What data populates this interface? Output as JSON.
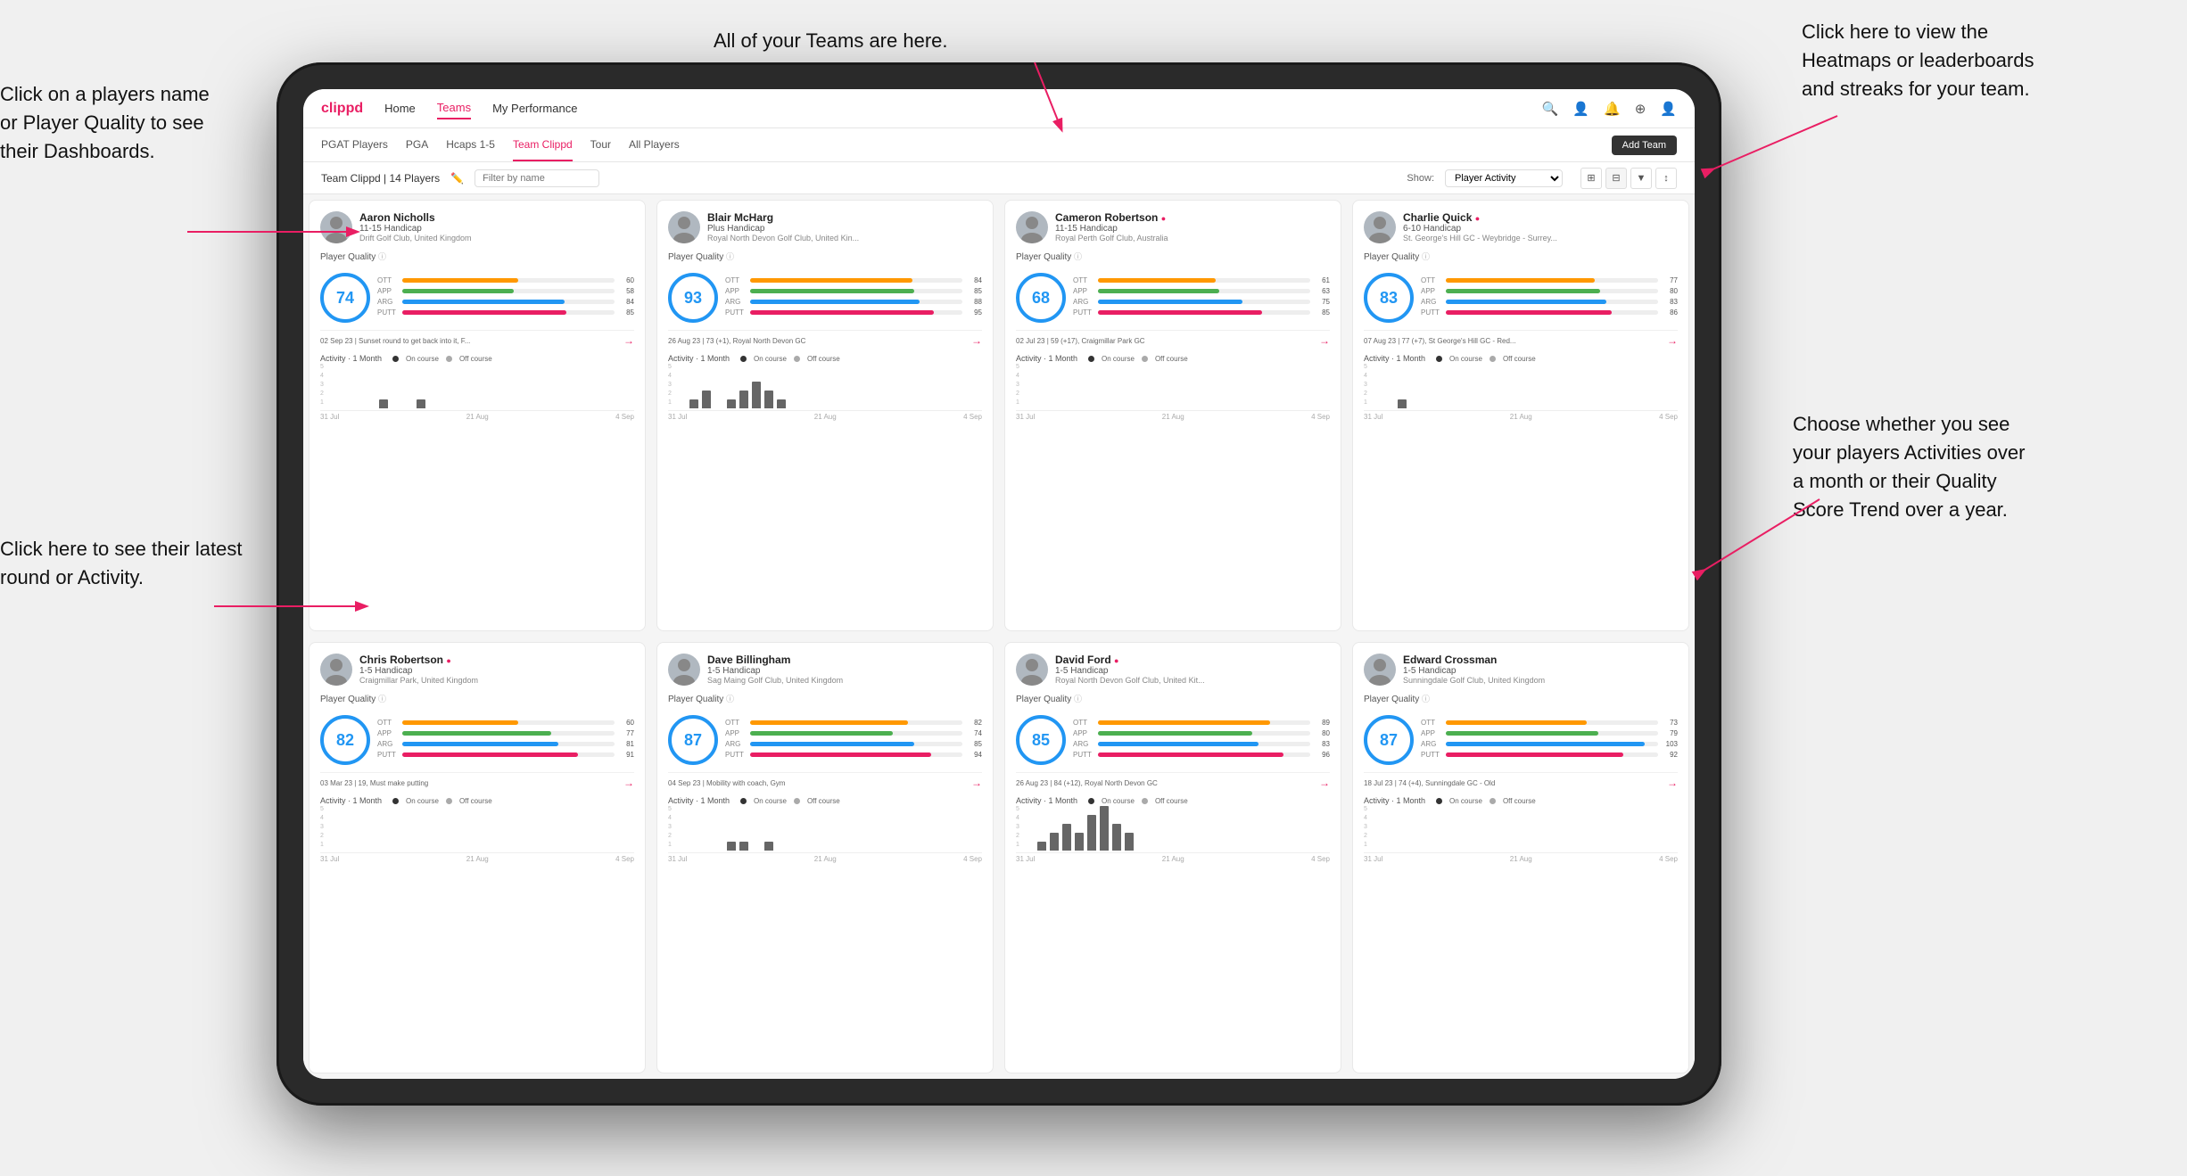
{
  "annotations": {
    "top_right_title": "Click here to view the\nHeatmaps or leaderboards\nand streaks for your team.",
    "top_center_title": "All of your Teams are here.",
    "left_top": "Click on a players name\nor Player Quality to see\ntheir Dashboards.",
    "left_bottom": "Click here to see their latest\nround or Activity.",
    "bottom_right": "Choose whether you see\nyour players Activities over\na month or their Quality\nScore Trend over a year."
  },
  "nav": {
    "logo": "clippd",
    "items": [
      "Home",
      "Teams",
      "My Performance"
    ],
    "active": "Teams",
    "icons": [
      "🔍",
      "👤",
      "🔔",
      "⊕",
      "👤"
    ]
  },
  "sub_nav": {
    "items": [
      "PGAT Players",
      "PGA",
      "Hcaps 1-5",
      "Team Clippd",
      "Tour",
      "All Players"
    ],
    "active": "Team Clippd",
    "add_button": "Add Team"
  },
  "team_header": {
    "title": "Team Clippd | 14 Players",
    "filter_placeholder": "Filter by name",
    "show_label": "Show:",
    "show_value": "Player Activity",
    "view_options": [
      "grid-2",
      "grid-4",
      "filter",
      "sort"
    ]
  },
  "players": [
    {
      "name": "Aaron Nicholls",
      "handicap": "11-15 Handicap",
      "club": "Drift Golf Club, United Kingdom",
      "verified": false,
      "score": 74,
      "score_color": "blue",
      "stats": [
        {
          "label": "OTT",
          "value": 60,
          "color": "#FF9800"
        },
        {
          "label": "APP",
          "value": 58,
          "color": "#4CAF50"
        },
        {
          "label": "ARG",
          "value": 84,
          "color": "#2196F3"
        },
        {
          "label": "PUTT",
          "value": 85,
          "color": "#e91e63"
        }
      ],
      "latest": "02 Sep 23 | Sunset round to get back into it, F...",
      "activity_bars": [
        0,
        0,
        0,
        0,
        1,
        0,
        0,
        1,
        0
      ],
      "chart_labels": [
        "31 Jul",
        "21 Aug",
        "4 Sep"
      ]
    },
    {
      "name": "Blair McHarg",
      "handicap": "Plus Handicap",
      "club": "Royal North Devon Golf Club, United Kin...",
      "verified": false,
      "score": 93,
      "score_color": "blue",
      "stats": [
        {
          "label": "OTT",
          "value": 84,
          "color": "#FF9800"
        },
        {
          "label": "APP",
          "value": 85,
          "color": "#4CAF50"
        },
        {
          "label": "ARG",
          "value": 88,
          "color": "#2196F3"
        },
        {
          "label": "PUTT",
          "value": 95,
          "color": "#e91e63"
        }
      ],
      "latest": "26 Aug 23 | 73 (+1), Royal North Devon GC",
      "activity_bars": [
        0,
        1,
        2,
        0,
        1,
        2,
        3,
        2,
        1
      ],
      "chart_labels": [
        "31 Jul",
        "21 Aug",
        "4 Sep"
      ]
    },
    {
      "name": "Cameron Robertson",
      "handicap": "11-15 Handicap",
      "club": "Royal Perth Golf Club, Australia",
      "verified": true,
      "score": 68,
      "score_color": "blue",
      "stats": [
        {
          "label": "OTT",
          "value": 61,
          "color": "#FF9800"
        },
        {
          "label": "APP",
          "value": 63,
          "color": "#4CAF50"
        },
        {
          "label": "ARG",
          "value": 75,
          "color": "#2196F3"
        },
        {
          "label": "PUTT",
          "value": 85,
          "color": "#e91e63"
        }
      ],
      "latest": "02 Jul 23 | 59 (+17), Craigmillar Park GC",
      "activity_bars": [
        0,
        0,
        0,
        0,
        0,
        0,
        0,
        0,
        0
      ],
      "chart_labels": [
        "31 Jul",
        "21 Aug",
        "4 Sep"
      ]
    },
    {
      "name": "Charlie Quick",
      "handicap": "6-10 Handicap",
      "club": "St. George's Hill GC - Weybridge - Surrey...",
      "verified": true,
      "score": 83,
      "score_color": "blue",
      "stats": [
        {
          "label": "OTT",
          "value": 77,
          "color": "#FF9800"
        },
        {
          "label": "APP",
          "value": 80,
          "color": "#4CAF50"
        },
        {
          "label": "ARG",
          "value": 83,
          "color": "#2196F3"
        },
        {
          "label": "PUTT",
          "value": 86,
          "color": "#e91e63"
        }
      ],
      "latest": "07 Aug 23 | 77 (+7), St George's Hill GC - Red...",
      "activity_bars": [
        0,
        0,
        1,
        0,
        0,
        0,
        0,
        0,
        0
      ],
      "chart_labels": [
        "31 Jul",
        "21 Aug",
        "4 Sep"
      ]
    },
    {
      "name": "Chris Robertson",
      "handicap": "1-5 Handicap",
      "club": "Craigmillar Park, United Kingdom",
      "verified": true,
      "score": 82,
      "score_color": "blue",
      "stats": [
        {
          "label": "OTT",
          "value": 60,
          "color": "#FF9800"
        },
        {
          "label": "APP",
          "value": 77,
          "color": "#4CAF50"
        },
        {
          "label": "ARG",
          "value": 81,
          "color": "#2196F3"
        },
        {
          "label": "PUTT",
          "value": 91,
          "color": "#e91e63"
        }
      ],
      "latest": "03 Mar 23 | 19, Must make putting",
      "activity_bars": [
        0,
        0,
        0,
        0,
        0,
        0,
        0,
        0,
        0
      ],
      "chart_labels": [
        "31 Jul",
        "21 Aug",
        "4 Sep"
      ]
    },
    {
      "name": "Dave Billingham",
      "handicap": "1-5 Handicap",
      "club": "Sag Maing Golf Club, United Kingdom",
      "verified": false,
      "score": 87,
      "score_color": "blue",
      "stats": [
        {
          "label": "OTT",
          "value": 82,
          "color": "#FF9800"
        },
        {
          "label": "APP",
          "value": 74,
          "color": "#4CAF50"
        },
        {
          "label": "ARG",
          "value": 85,
          "color": "#2196F3"
        },
        {
          "label": "PUTT",
          "value": 94,
          "color": "#e91e63"
        }
      ],
      "latest": "04 Sep 23 | Mobility with coach, Gym",
      "activity_bars": [
        0,
        0,
        0,
        0,
        1,
        1,
        0,
        1,
        0
      ],
      "chart_labels": [
        "31 Jul",
        "21 Aug",
        "4 Sep"
      ]
    },
    {
      "name": "David Ford",
      "handicap": "1-5 Handicap",
      "club": "Royal North Devon Golf Club, United Kit...",
      "verified": true,
      "score": 85,
      "score_color": "blue",
      "stats": [
        {
          "label": "OTT",
          "value": 89,
          "color": "#FF9800"
        },
        {
          "label": "APP",
          "value": 80,
          "color": "#4CAF50"
        },
        {
          "label": "ARG",
          "value": 83,
          "color": "#2196F3"
        },
        {
          "label": "PUTT",
          "value": 96,
          "color": "#e91e63"
        }
      ],
      "latest": "26 Aug 23 | 84 (+12), Royal North Devon GC",
      "activity_bars": [
        0,
        1,
        2,
        3,
        2,
        4,
        5,
        3,
        2
      ],
      "chart_labels": [
        "31 Jul",
        "21 Aug",
        "4 Sep"
      ]
    },
    {
      "name": "Edward Crossman",
      "handicap": "1-5 Handicap",
      "club": "Sunningdale Golf Club, United Kingdom",
      "verified": false,
      "score": 87,
      "score_color": "blue",
      "stats": [
        {
          "label": "OTT",
          "value": 73,
          "color": "#FF9800"
        },
        {
          "label": "APP",
          "value": 79,
          "color": "#4CAF50"
        },
        {
          "label": "ARG",
          "value": 103,
          "color": "#2196F3"
        },
        {
          "label": "PUTT",
          "value": 92,
          "color": "#e91e63"
        }
      ],
      "latest": "18 Jul 23 | 74 (+4), Sunningdale GC - Old",
      "activity_bars": [
        0,
        0,
        0,
        0,
        0,
        0,
        0,
        0,
        0
      ],
      "chart_labels": [
        "31 Jul",
        "21 Aug",
        "4 Sep"
      ]
    }
  ]
}
